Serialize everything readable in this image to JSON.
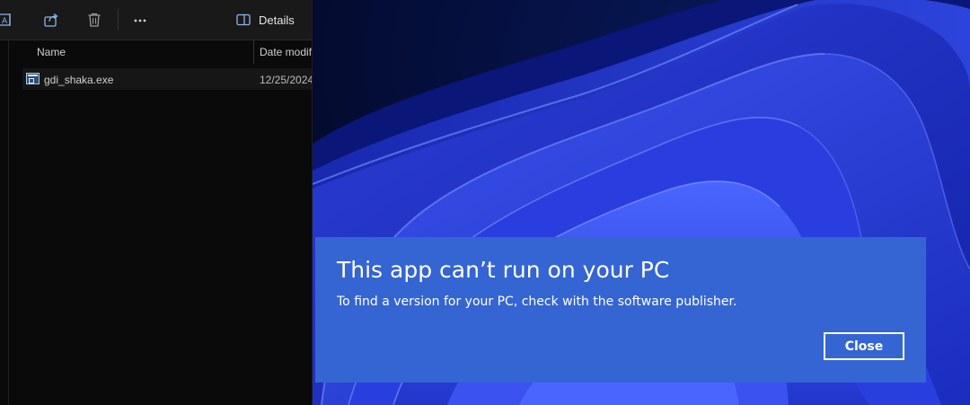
{
  "explorer": {
    "toolbar": {
      "rename_icon": "rename-icon",
      "share_icon": "share-icon",
      "delete_icon": "trash-icon",
      "more_icon": "more-options-icon",
      "details_label": "Details"
    },
    "columns": {
      "name": "Name",
      "date": "Date modif"
    },
    "files": [
      {
        "name": "gdi_shaka.exe",
        "date": "12/25/2024"
      }
    ]
  },
  "dialog": {
    "title": "This app can’t run on your PC",
    "message": "To find a version for your PC, check with the software publisher.",
    "close_label": "Close",
    "background_color": "#3465d2"
  }
}
